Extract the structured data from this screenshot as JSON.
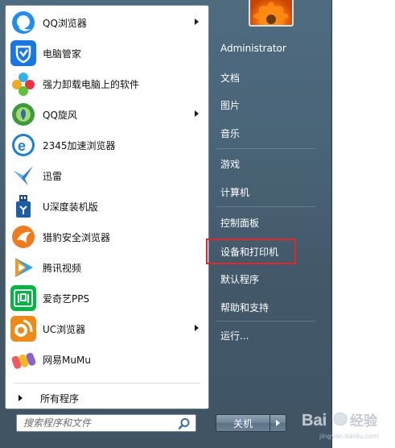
{
  "programs": [
    {
      "label": "QQ浏览器",
      "icon": "qq-browser-icon",
      "has_submenu": true
    },
    {
      "label": "电脑管家",
      "icon": "pc-manager-icon",
      "has_submenu": false
    },
    {
      "label": "强力卸载电脑上的软件",
      "icon": "uninstaller-icon",
      "has_submenu": false
    },
    {
      "label": "QQ旋风",
      "icon": "qq-whirlwind-icon",
      "has_submenu": true
    },
    {
      "label": "2345加速浏览器",
      "icon": "2345-browser-icon",
      "has_submenu": false
    },
    {
      "label": "迅雷",
      "icon": "thunder-icon",
      "has_submenu": false
    },
    {
      "label": "U深度装机版",
      "icon": "udeep-icon",
      "has_submenu": false
    },
    {
      "label": "猎豹安全浏览器",
      "icon": "liebao-browser-icon",
      "has_submenu": false
    },
    {
      "label": "腾讯视频",
      "icon": "tencent-video-icon",
      "has_submenu": false
    },
    {
      "label": "爱奇艺PPS",
      "icon": "iqiyi-icon",
      "has_submenu": false
    },
    {
      "label": "UC浏览器",
      "icon": "uc-browser-icon",
      "has_submenu": true
    },
    {
      "label": "网易MuMu",
      "icon": "mumu-icon",
      "has_submenu": false
    }
  ],
  "all_programs_label": "所有程序",
  "search": {
    "placeholder": "搜索程序和文件"
  },
  "right_items": [
    {
      "label": "Administrator",
      "name": "user-administrator"
    },
    {
      "label": "文档",
      "name": "documents"
    },
    {
      "label": "图片",
      "name": "pictures"
    },
    {
      "label": "音乐",
      "name": "music"
    },
    {
      "label": "游戏",
      "name": "games"
    },
    {
      "label": "计算机",
      "name": "computer"
    },
    {
      "label": "控制面板",
      "name": "control-panel"
    },
    {
      "label": "设备和打印机",
      "name": "devices-and-printers"
    },
    {
      "label": "默认程序",
      "name": "default-programs"
    },
    {
      "label": "帮助和支持",
      "name": "help-and-support"
    },
    {
      "label": "运行...",
      "name": "run"
    }
  ],
  "shutdown_label": "关机",
  "watermark": {
    "brand": "Bai",
    "suffix": "经验",
    "url": "jingyan.baidu.com"
  },
  "colors": {
    "highlight_border": "#e0272c",
    "menu_background": "#4a6578"
  }
}
